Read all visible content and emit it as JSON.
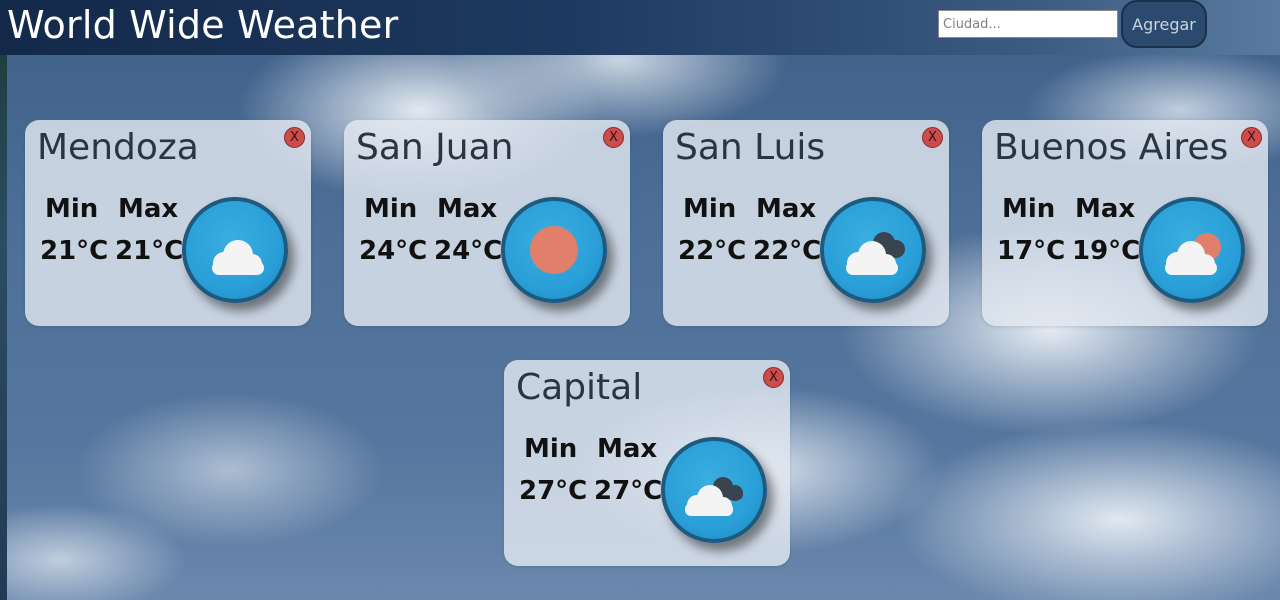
{
  "app": {
    "title": "World Wide Weather"
  },
  "search": {
    "placeholder": "Ciudad...",
    "value": "",
    "button_label": "Agregar"
  },
  "labels": {
    "min": "Min",
    "max": "Max",
    "close": "X"
  },
  "cities": [
    {
      "name": "Mendoza",
      "min": "21°C",
      "max": "21°C",
      "icon": "cloud-icon"
    },
    {
      "name": "San Juan",
      "min": "24°C",
      "max": "24°C",
      "icon": "sun-icon"
    },
    {
      "name": "San Luis",
      "min": "22°C",
      "max": "22°C",
      "icon": "broken-clouds-icon"
    },
    {
      "name": "Buenos Aires",
      "min": "17°C",
      "max": "19°C",
      "icon": "partly-cloudy-icon"
    },
    {
      "name": "Capital",
      "min": "27°C",
      "max": "27°C",
      "icon": "broken-clouds-icon"
    }
  ],
  "colors": {
    "header": "#1e3a60",
    "close_button": "#cc4c4c",
    "icon_background": "#2a9fd8",
    "sun": "#e0806a"
  }
}
